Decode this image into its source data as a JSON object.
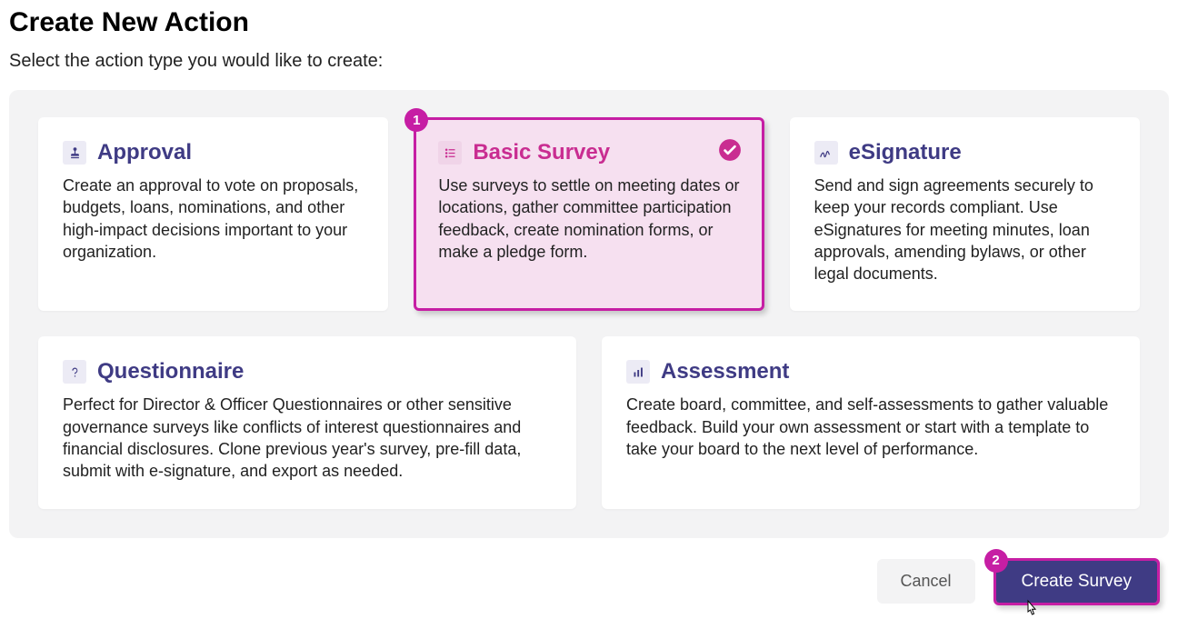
{
  "page_title": "Create New Action",
  "subtitle": "Select the action type you would like to create:",
  "step_badges": {
    "one": "1",
    "two": "2"
  },
  "cards": {
    "approval": {
      "title": "Approval",
      "desc": "Create an approval to vote on proposals, budgets, loans, nominations, and other high-impact decisions important to your organization."
    },
    "basic_survey": {
      "title": "Basic Survey",
      "desc": "Use surveys to settle on meeting dates or locations, gather committee participation feedback, create nomination forms, or make a pledge form.",
      "selected": true
    },
    "esignature": {
      "title": "eSignature",
      "desc": "Send and sign agreements securely to keep your records compliant. Use eSignatures for meeting minutes, loan approvals, amending bylaws, or other legal documents."
    },
    "questionnaire": {
      "title": "Questionnaire",
      "desc": "Perfect for Director & Officer Questionnaires or other sensitive governance surveys like conflicts of interest questionnaires and financial disclosures. Clone previous year's survey, pre-fill data, submit with e-signature, and export as needed."
    },
    "assessment": {
      "title": "Assessment",
      "desc": "Create board, committee, and self-assessments to gather valuable feedback. Build your own assessment or start with a template to take your board to the next level of performance."
    }
  },
  "footer": {
    "cancel_label": "Cancel",
    "create_label": "Create Survey"
  }
}
